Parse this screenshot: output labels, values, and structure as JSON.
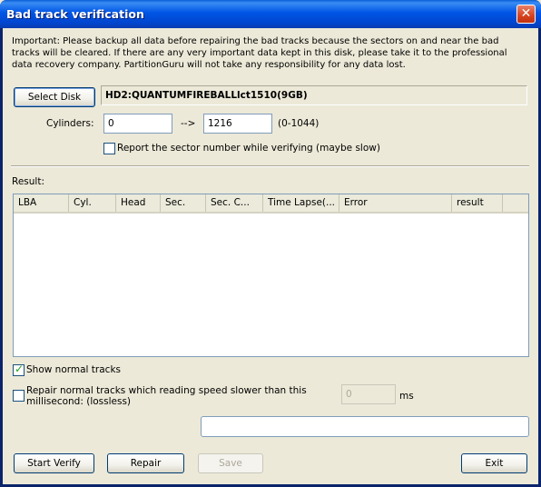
{
  "window": {
    "title": "Bad track verification"
  },
  "notice": "Important: Please backup all data before repairing the bad tracks because the sectors on and near the bad tracks will be cleared. If there are any very important data kept in this disk, please take it to the professional data recovery company. PartitionGuru will not take any responsibility for any data lost.",
  "disk": {
    "select_label": "Select Disk",
    "name": "HD2:QUANTUMFIREBALLlct1510(9GB)"
  },
  "cylinders": {
    "label": "Cylinders:",
    "from": "0",
    "arrow": "-->",
    "to": "1216",
    "range": "(0-1044)"
  },
  "report_sector": {
    "label": "Report the sector number while verifying (maybe slow)",
    "checked": false
  },
  "result": {
    "label": "Result:",
    "columns": [
      "LBA",
      "Cyl.",
      "Head",
      "Sec.",
      "Sec. C...",
      "Time Lapse(...",
      "Error",
      "result"
    ]
  },
  "show_normal": {
    "label": "Show normal tracks",
    "checked": true
  },
  "repair_slow": {
    "label": "Repair normal tracks which reading speed slower than this millisecond: (lossless)",
    "checked": false,
    "value": "0",
    "unit": "ms"
  },
  "buttons": {
    "start": "Start Verify",
    "repair": "Repair",
    "save": "Save",
    "exit": "Exit"
  }
}
